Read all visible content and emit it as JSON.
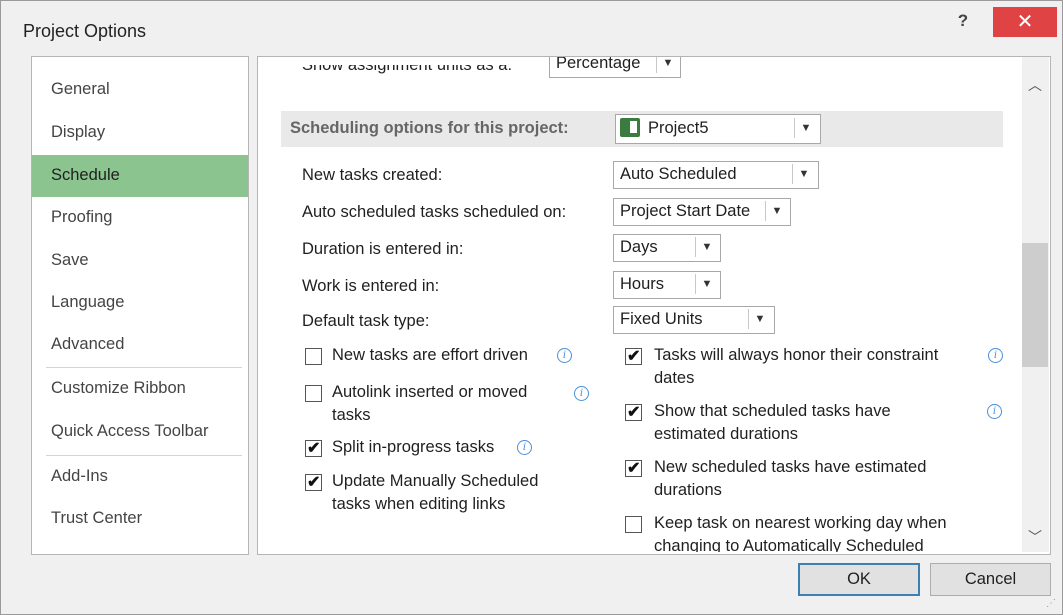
{
  "window": {
    "title": "Project Options",
    "help_label": "?",
    "close_label": "✕"
  },
  "sidebar": {
    "items": [
      {
        "label": "General"
      },
      {
        "label": "Display"
      },
      {
        "label": "Schedule"
      },
      {
        "label": "Proofing"
      },
      {
        "label": "Save"
      },
      {
        "label": "Language"
      },
      {
        "label": "Advanced"
      },
      {
        "label": "Customize Ribbon"
      },
      {
        "label": "Quick Access Toolbar"
      },
      {
        "label": "Add-Ins"
      },
      {
        "label": "Trust Center"
      }
    ],
    "active": "Schedule"
  },
  "content": {
    "assignment_units": {
      "label": "Show assignment units as a:",
      "value": "Percentage"
    },
    "section": {
      "title": "Scheduling options for this project:",
      "project": "Project5"
    },
    "fields": {
      "new_tasks": {
        "label": "New tasks created:",
        "value": "Auto Scheduled"
      },
      "auto_scheduled_on": {
        "label": "Auto scheduled tasks scheduled on:",
        "value": "Project Start Date"
      },
      "duration": {
        "label": "Duration is entered in:",
        "value": "Days"
      },
      "work": {
        "label": "Work is entered in:",
        "value": "Hours"
      },
      "task_type": {
        "label": "Default task type:",
        "value": "Fixed Units"
      }
    },
    "checkboxes_left": [
      {
        "line1": "New tasks are effort driven",
        "line2": "",
        "checked": false
      },
      {
        "line1": "Autolink inserted or moved",
        "line2": "tasks",
        "checked": false
      },
      {
        "line1": "Split in-progress tasks",
        "line2": "",
        "checked": true
      },
      {
        "line1": "Update Manually Scheduled",
        "line2": "tasks when editing links",
        "checked": true
      }
    ],
    "checkboxes_right": [
      {
        "line1": "Tasks will always honor their constraint",
        "line2": "dates",
        "checked": true
      },
      {
        "line1": "Show that scheduled tasks have",
        "line2": "estimated durations",
        "checked": true
      },
      {
        "line1": "New scheduled tasks have estimated",
        "line2": "durations",
        "checked": true
      },
      {
        "line1": "Keep task on nearest working day when",
        "line2": "changing to Automatically Scheduled",
        "checked": false
      }
    ]
  },
  "footer": {
    "ok_label": "OK",
    "cancel_label": "Cancel"
  },
  "icons": {
    "dropdown": "chevron-down-icon",
    "info": "info-icon",
    "checkmark": "✔"
  }
}
